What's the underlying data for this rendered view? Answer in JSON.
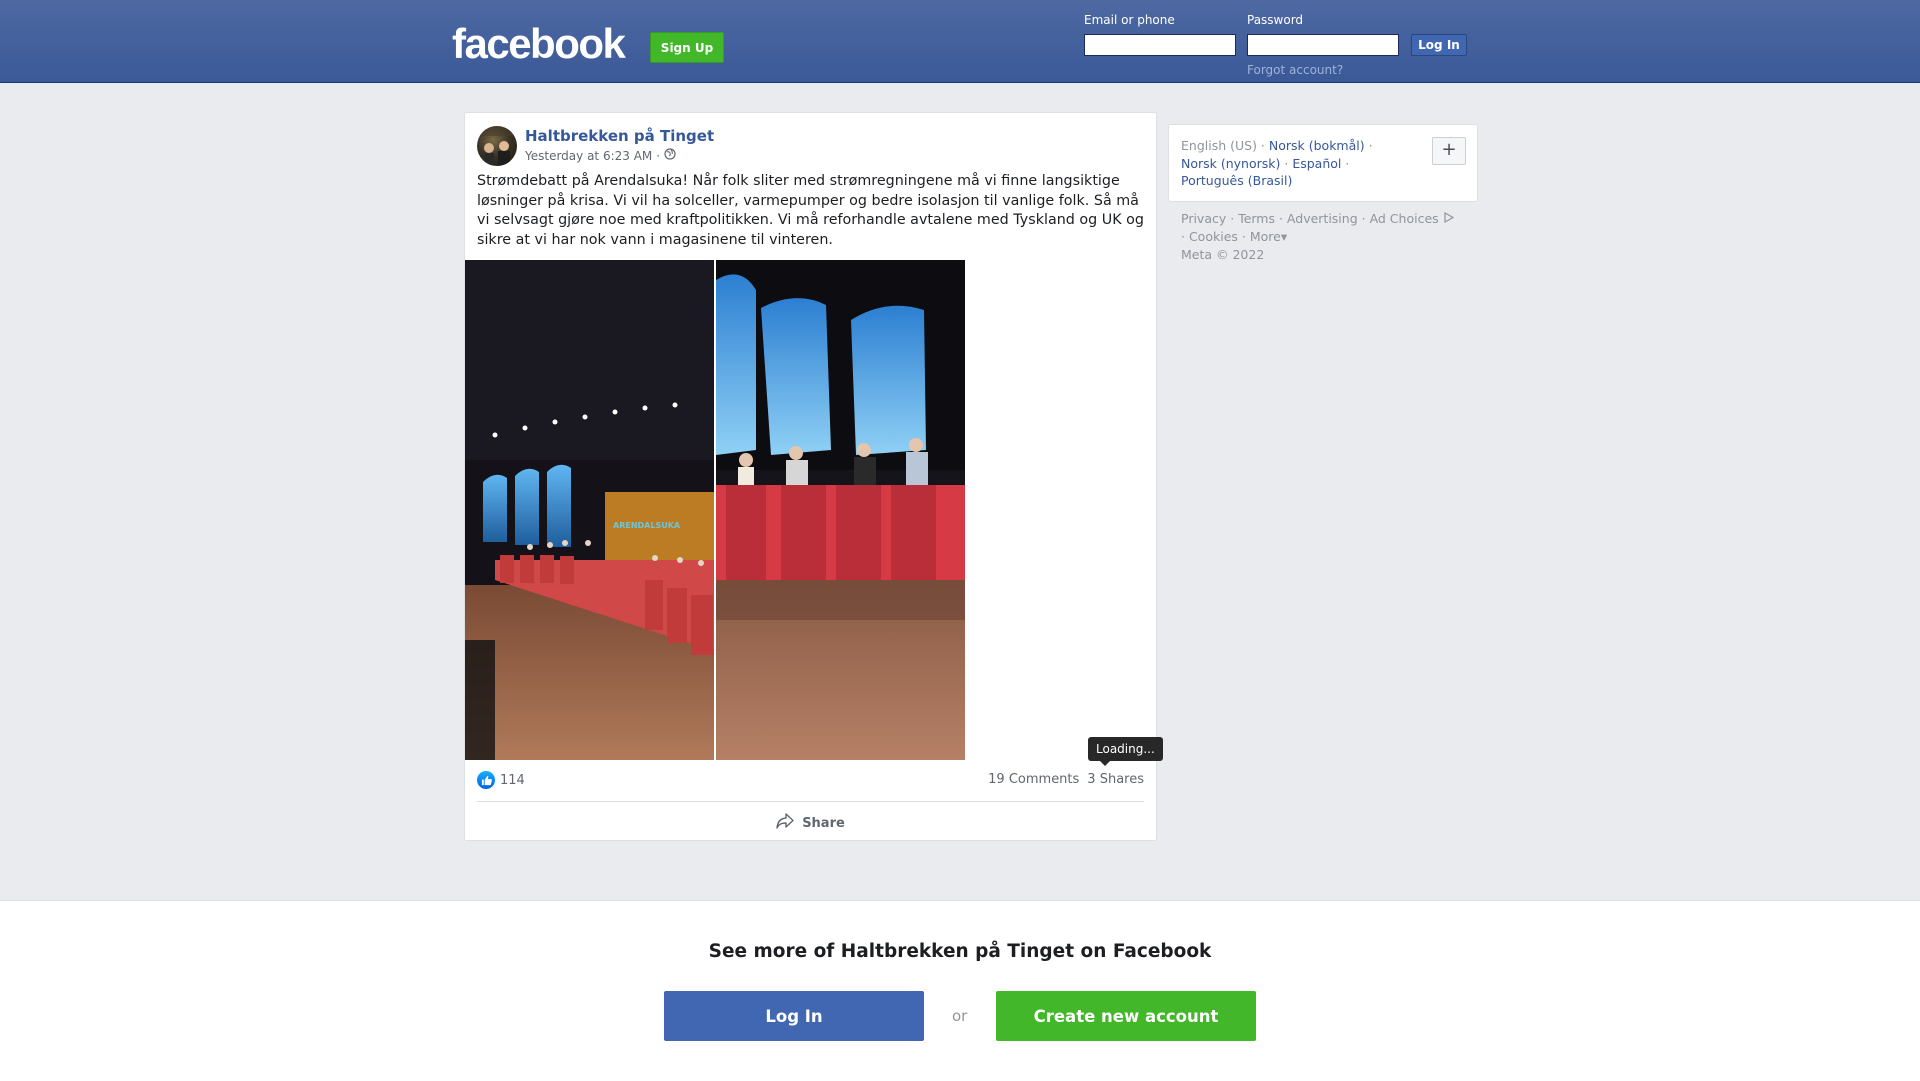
{
  "header": {
    "logo_text": "facebook",
    "signup_label": "Sign Up",
    "email_label": "Email or phone",
    "password_label": "Password",
    "login_label": "Log In",
    "forgot_label": "Forgot account?"
  },
  "post": {
    "author": "Haltbrekken på Tinget",
    "timestamp": "Yesterday at 6:23 AM",
    "separator": "·",
    "privacy_icon": "globe-icon",
    "text": "Strømdebatt på Arendalsuka! Når folk sliter med strømregningene må vi finne langsiktige løsninger på krisa. Vi vil ha solceller, varmepumper og bedre isolasjon til vanlige folk. Så må vi selvsagt gjøre noe med kraftpolitikken. Vi må reforhandle avtalene med Tyskland og UK og sikre at vi har nok vann i magasinene til vinteren.",
    "photo1_overlay_text": "ARENDALSUKA",
    "like_count": "114",
    "comments": "19 Comments",
    "shares": "3 Shares",
    "tooltip": "Loading...",
    "share_label": "Share"
  },
  "languages": {
    "current": "English (US)",
    "options": [
      "Norsk (bokmål)",
      "Norsk (nynorsk)",
      "Español",
      "Português (Brasil)"
    ],
    "more_label": "+"
  },
  "footer": {
    "links": [
      "Privacy",
      "Terms",
      "Advertising",
      "Ad Choices",
      "Cookies",
      "More"
    ],
    "copyright": "Meta © 2022"
  },
  "bottom": {
    "title": "See more of Haltbrekken på Tinget on Facebook",
    "login_label": "Log In",
    "or_label": "or",
    "create_label": "Create new account"
  },
  "colors": {
    "header_bg": "#3b5998",
    "signup_green": "#42b72a",
    "link_blue": "#365899",
    "page_bg": "#e9ebee"
  }
}
